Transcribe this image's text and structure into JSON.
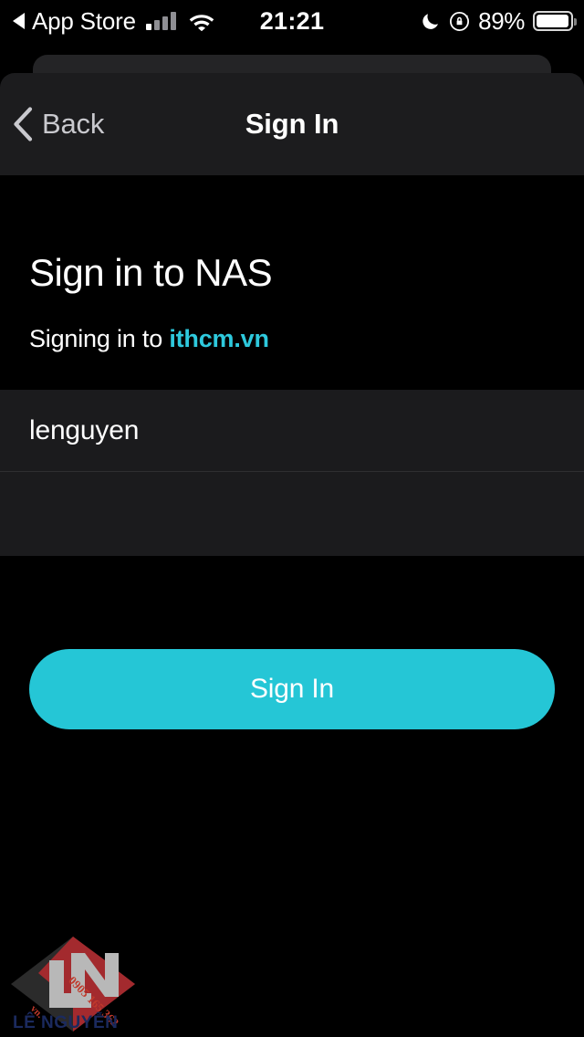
{
  "statusbar": {
    "back_app_label": "App Store",
    "back_arrow_icon": "triangle-left-icon",
    "signal_icon": "cellular-signal-icon",
    "wifi_icon": "wifi-icon",
    "time": "21:21",
    "dnd_icon": "moon-icon",
    "rotation_lock_icon": "rotation-lock-icon",
    "battery_percent": "89%",
    "battery_icon": "battery-icon",
    "battery_level": 89
  },
  "navbar": {
    "back_icon": "chevron-left-icon",
    "back_label": "Back",
    "title": "Sign In"
  },
  "content": {
    "heading": "Sign in to NAS",
    "subheading_prefix": "Signing in to ",
    "subheading_domain": "ithcm.vn",
    "link_color": "#2ec9dd"
  },
  "form": {
    "fields": [
      {
        "name": "username",
        "value": "lenguyen",
        "placeholder": ""
      },
      {
        "name": "password",
        "value": "",
        "placeholder": ""
      }
    ],
    "submit_label": "Sign In",
    "submit_color": "#25c6d6"
  },
  "watermark": {
    "brand": "LÊ NGUYỄN",
    "monogram": "LN",
    "phone": "0905 165 362",
    "tld": "vn.",
    "diamond_dark": "#2b2b2b",
    "diamond_red": "#a32a2e",
    "monogram_color": "#b8b8b8",
    "brand_color": "#1b2a5e"
  }
}
